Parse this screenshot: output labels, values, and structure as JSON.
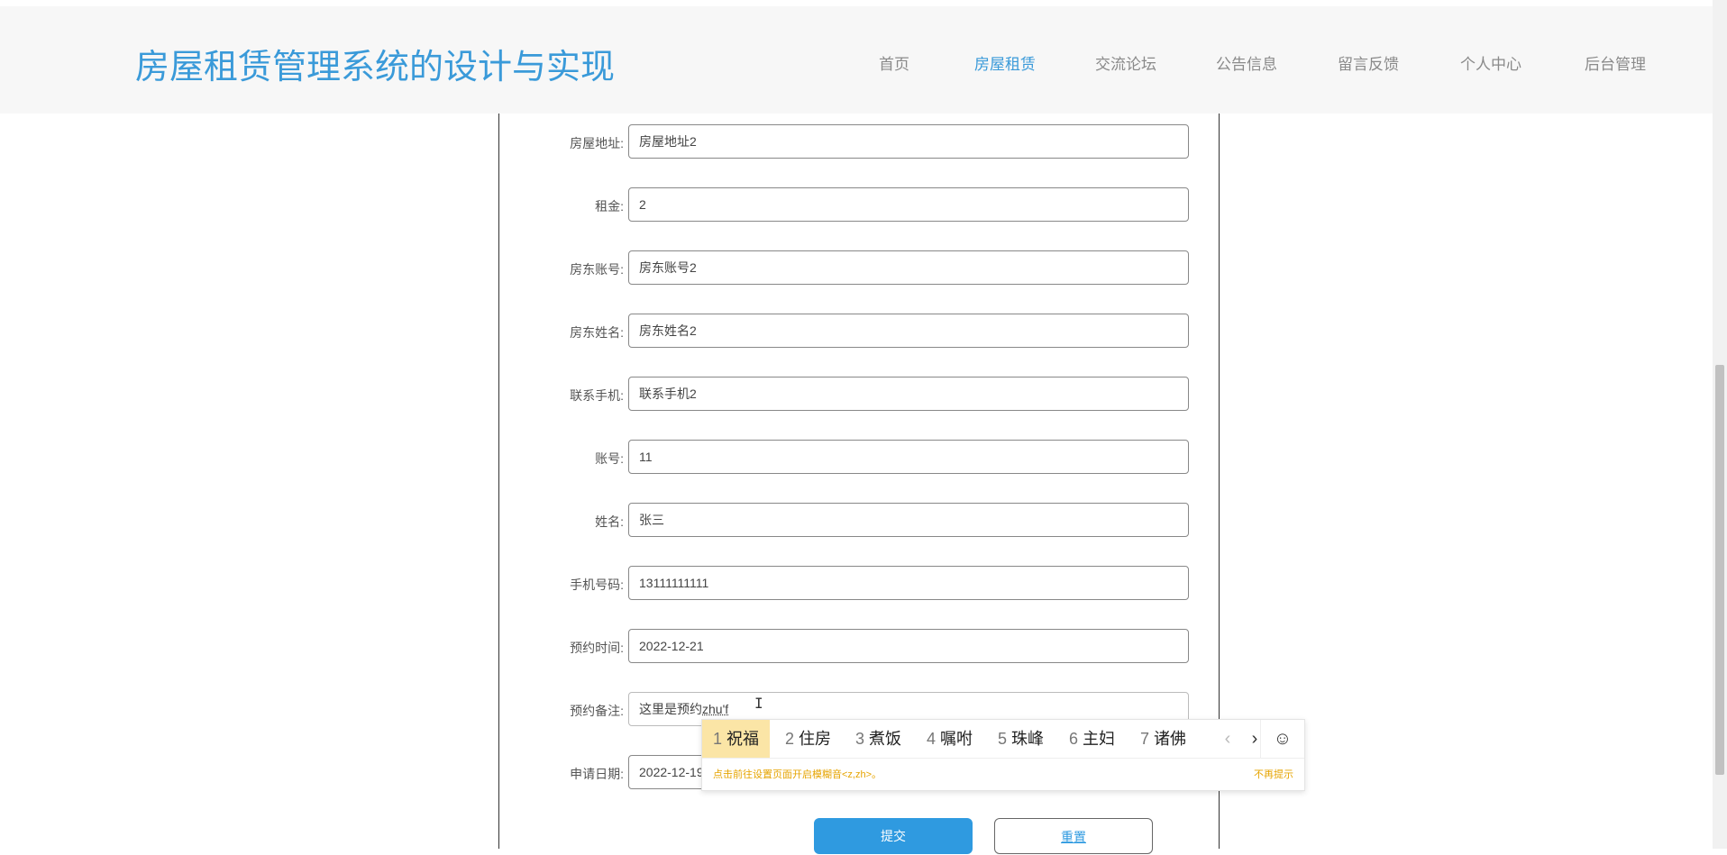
{
  "header": {
    "title": "房屋租赁管理系统的设计与实现",
    "nav": [
      {
        "label": "首页",
        "active": false
      },
      {
        "label": "房屋租赁",
        "active": true
      },
      {
        "label": "交流论坛",
        "active": false
      },
      {
        "label": "公告信息",
        "active": false
      },
      {
        "label": "留言反馈",
        "active": false
      },
      {
        "label": "个人中心",
        "active": false
      },
      {
        "label": "后台管理",
        "active": false
      }
    ]
  },
  "form": {
    "fields": [
      {
        "label": "房屋地址:",
        "value": "房屋地址2"
      },
      {
        "label": "租金:",
        "value": "2"
      },
      {
        "label": "房东账号:",
        "value": "房东账号2"
      },
      {
        "label": "房东姓名:",
        "value": "房东姓名2"
      },
      {
        "label": "联系手机:",
        "value": "联系手机2"
      },
      {
        "label": "账号:",
        "value": "11"
      },
      {
        "label": "姓名:",
        "value": "张三"
      },
      {
        "label": "手机号码:",
        "value": "13111111111"
      },
      {
        "label": "预约时间:",
        "value": "2022-12-21"
      },
      {
        "label": "预约备注:",
        "value_committed": "这里是预约",
        "value_composing": "zhu'f"
      },
      {
        "label": "申请日期:",
        "value": "2022-12-19"
      }
    ],
    "submit_label": "提交",
    "reset_label": "重置"
  },
  "ime": {
    "candidates": [
      {
        "num": "1",
        "text": "祝福"
      },
      {
        "num": "2",
        "text": "住房"
      },
      {
        "num": "3",
        "text": "煮饭"
      },
      {
        "num": "4",
        "text": "嘱咐"
      },
      {
        "num": "5",
        "text": "珠峰"
      },
      {
        "num": "6",
        "text": "主妇"
      },
      {
        "num": "7",
        "text": "诸佛"
      }
    ],
    "prev_icon": "chevron-left-icon",
    "next_icon": "chevron-right-icon",
    "emoji_icon": "smiley-icon",
    "tip": "点击前往设置页面开启模糊音<z,zh>。",
    "dismiss": "不再提示"
  },
  "colors": {
    "accent": "#3a9ad9",
    "button": "#2f9ae0",
    "ime_highlight": "#fbe5a6",
    "ime_tip": "#e6a400"
  }
}
